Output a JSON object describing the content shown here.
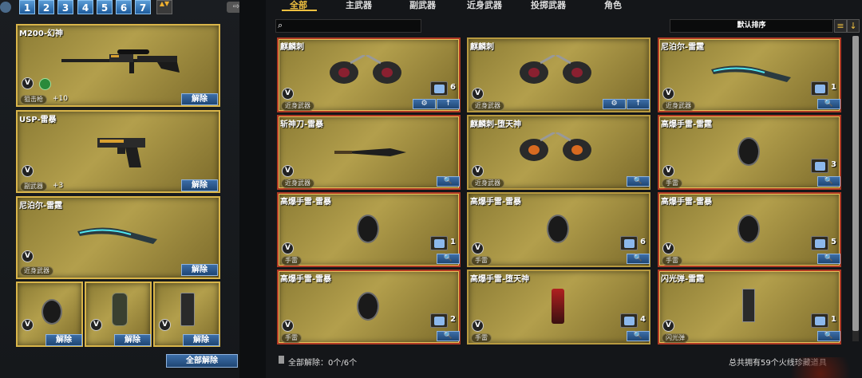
{
  "pagination": {
    "pages": [
      "1",
      "2",
      "3",
      "4",
      "5",
      "6",
      "7"
    ],
    "updown": "▲▼",
    "share_icon": "share-icon"
  },
  "left": {
    "equipped": [
      {
        "name": "M200-幻神",
        "category": "狙击枪",
        "bonus": "+10"
      },
      {
        "name": "USP-雷暴",
        "category": "副武器",
        "bonus": "+3"
      },
      {
        "name": "尼泊尔-雷霆",
        "category": "近身武器",
        "bonus": ""
      }
    ],
    "unlock_label": "解除",
    "all_unlock_label": "全部解除",
    "v_label": "V"
  },
  "tabs": [
    "全部",
    "主武器",
    "副武器",
    "近身武器",
    "投掷武器",
    "角色"
  ],
  "active_tab": "全部",
  "sort_label": "默认排序",
  "grid": [
    {
      "name": "麒麟刺",
      "category": "近身武器",
      "count": "6",
      "buttons": [
        "⚙",
        "↑"
      ]
    },
    {
      "name": "麒麟刺",
      "category": "近身武器",
      "count": "",
      "buttons": [
        "⚙",
        "↑"
      ]
    },
    {
      "name": "尼泊尔-雷霆",
      "category": "近身武器",
      "count": "1",
      "buttons": [
        "🔍"
      ]
    },
    {
      "name": "斩神刀-雷暴",
      "category": "近身武器",
      "count": "",
      "buttons": [
        "🔍"
      ]
    },
    {
      "name": "麒麟刺-堕天神",
      "category": "近身武器",
      "count": "",
      "buttons": [
        "🔍"
      ]
    },
    {
      "name": "高爆手雷-雷霆",
      "category": "手雷",
      "count": "3",
      "buttons": [
        "🔍"
      ]
    },
    {
      "name": "高爆手雷-雷暴",
      "category": "手雷",
      "count": "1",
      "buttons": [
        "🔍"
      ]
    },
    {
      "name": "高爆手雷-雷暴",
      "category": "手雷",
      "count": "6",
      "buttons": [
        "🔍"
      ]
    },
    {
      "name": "高爆手雷-雷暴",
      "category": "手雷",
      "count": "5",
      "buttons": [
        "🔍"
      ]
    },
    {
      "name": "高爆手雷-雷暴",
      "category": "手雷",
      "count": "2",
      "buttons": [
        "🔍"
      ]
    },
    {
      "name": "高爆手雷-堕天神",
      "category": "手雷",
      "count": "4",
      "buttons": [
        "🔍"
      ]
    },
    {
      "name": "闪光弹-雷霆",
      "category": "闪光弹",
      "count": "1",
      "buttons": [
        "🔍"
      ]
    }
  ],
  "footer": {
    "left": "全部解除：0个/6个",
    "right": "总共拥有59个火线珍藏道具"
  }
}
